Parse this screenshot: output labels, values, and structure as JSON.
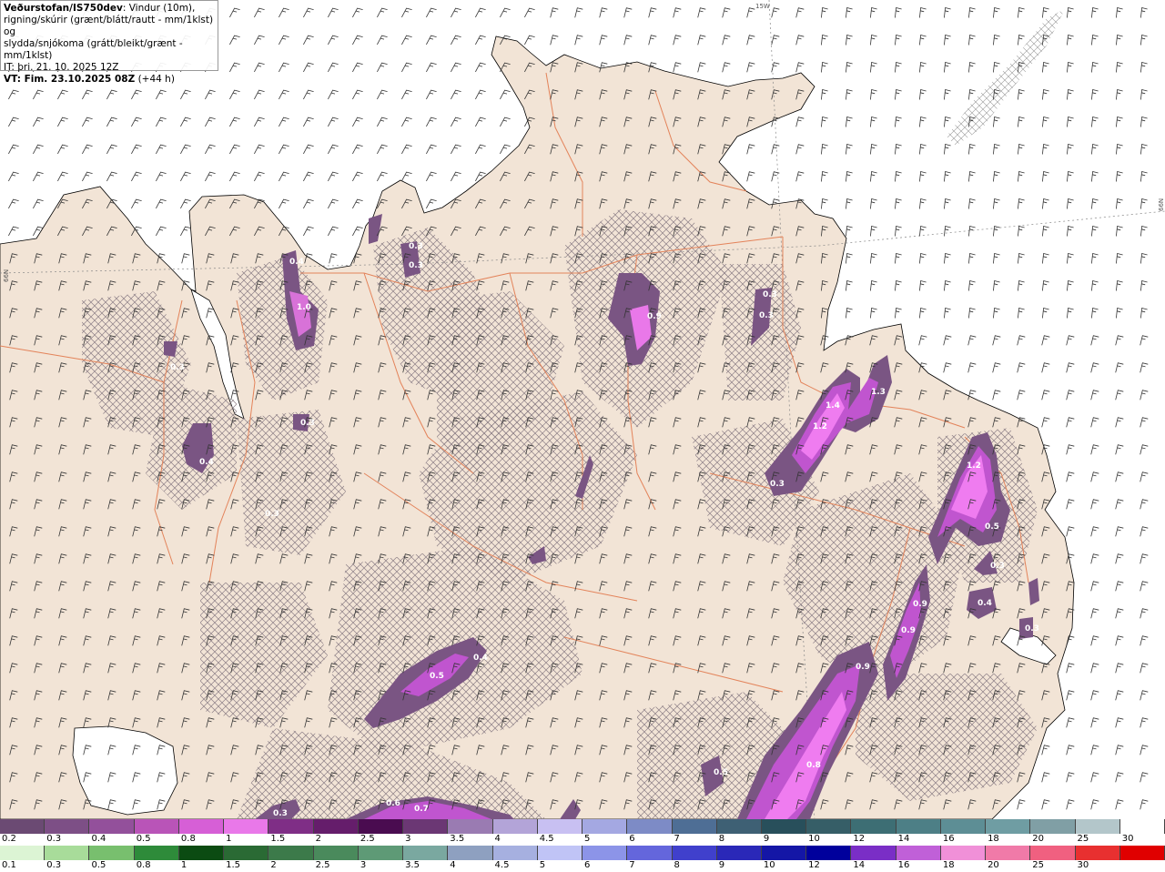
{
  "header": {
    "brand": "Veðurstofan/IS750dev",
    "line1_rest": ": Vindur (10m),",
    "line2": "rigning/skúrir (grænt/blátt/rautt - mm/1klst) og",
    "line3": "slydda/snjókoma (grátt/bleikt/grænt - mm/1klst)",
    "it": "IT: þri. 21. 10. 2025 12Z",
    "vt": "VT: Fim. 23.10.2025 08Z",
    "vt_offset": " (+44 h)"
  },
  "grid_labels": {
    "lon": "15W",
    "lat_left": "66N",
    "lat_right": "66N"
  },
  "map_labels": [
    "0.4",
    "0.3",
    "0.3",
    "1.0",
    "0.9",
    "0.3",
    "0.3",
    "0.3",
    "0.3",
    "0.4",
    "1.4",
    "1.3",
    "1.2",
    "0.3",
    "1.2",
    "0.5",
    "0.3",
    "0.4",
    "0.3",
    "0.9",
    "0.9",
    "0.9",
    "0.3",
    "0.4",
    "0.5",
    "0.5",
    "0.6",
    "0.7",
    "0.3",
    "0.8"
  ],
  "scale_top": {
    "labels": [
      "0.2",
      "0.3",
      "0.4",
      "0.5",
      "0.8",
      "1",
      "1.5",
      "2",
      "2.5",
      "3",
      "3.5",
      "4",
      "4.5",
      "5",
      "6",
      "7",
      "8",
      "9",
      "10",
      "12",
      "14",
      "16",
      "18",
      "20",
      "25",
      "30"
    ],
    "colors": [
      "#6b4a73",
      "#7d4f86",
      "#93509b",
      "#b954b8",
      "#d65fd6",
      "#e978e9",
      "#7f2e86",
      "#651d6b",
      "#4a0c50",
      "#6b3774",
      "#9a7bb2",
      "#b3a4d8",
      "#c8c0f2",
      "#a4a8e2",
      "#7d8bc6",
      "#4e6e95",
      "#3e6074",
      "#284f5b",
      "#365e67",
      "#3d6e74",
      "#4d7f86",
      "#5d8e95",
      "#6f9da3",
      "#809fa5",
      "#b3c6ca",
      "#ffffff"
    ]
  },
  "scale_bottom": {
    "labels": [
      "0.1",
      "0.3",
      "0.5",
      "0.8",
      "1",
      "1.5",
      "2",
      "2.5",
      "3",
      "3.5",
      "4",
      "4.5",
      "5",
      "6",
      "7",
      "8",
      "9",
      "10",
      "12",
      "14",
      "16",
      "18",
      "20",
      "25",
      "30"
    ],
    "colors": [
      "#dcf4d4",
      "#a8dc9a",
      "#78bf6e",
      "#2e8b3a",
      "#0b4b12",
      "#2a6a34",
      "#3c7a4a",
      "#4a8a5c",
      "#5e9a76",
      "#7aa8a0",
      "#8ea0c0",
      "#a6b0e0",
      "#c0c4f6",
      "#8c94e8",
      "#6466dc",
      "#4040cc",
      "#2a28b8",
      "#1416a6",
      "#00009c",
      "#7a2ec6",
      "#c060d8",
      "#f090d8",
      "#f07aa8",
      "#f06080",
      "#e83030",
      "#e00000"
    ]
  },
  "colors": {
    "land": "#f2e4d6",
    "sea": "#ffffff",
    "roads": "#e3835a",
    "hatch": "#8c7f86",
    "snow": "#7a5583",
    "snow_heavy": "#c055cf",
    "snow_peak": "#ef7cf0"
  }
}
